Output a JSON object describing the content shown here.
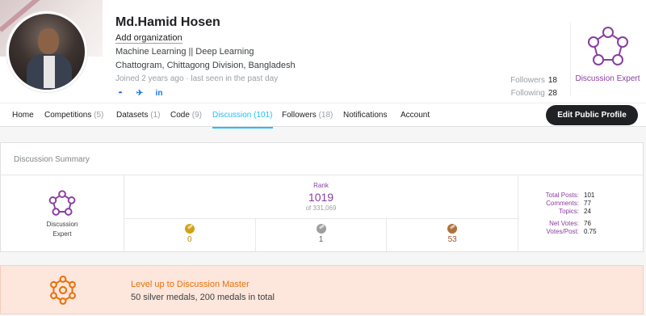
{
  "profile": {
    "name": "Md.Hamid Hosen",
    "add_org": "Add organization",
    "occupation": "Machine Learning || Deep Learning",
    "location": "Chattogram, Chittagong Division, Bangladesh",
    "joined": "Joined 2 years ago · last seen in the past day",
    "socials": [
      {
        "icon": "github-icon",
        "glyph": "◓"
      },
      {
        "icon": "twitter-icon",
        "glyph": "✈"
      },
      {
        "icon": "linkedin-icon",
        "glyph": "in"
      }
    ],
    "followers_label": "Followers",
    "followers_count": "18",
    "following_label": "Following",
    "following_count": "28",
    "tier": "Discussion Expert",
    "tier_color": "#8a3ea0"
  },
  "tabs": [
    {
      "label": "Home",
      "count": ""
    },
    {
      "label": "Competitions",
      "count": "(5)"
    },
    {
      "label": "Datasets",
      "count": "(1)"
    },
    {
      "label": "Code",
      "count": "(9)"
    },
    {
      "label": "Discussion",
      "count": "(101)",
      "active": true
    },
    {
      "label": "Followers",
      "count": "(18)"
    },
    {
      "label": "Notifications",
      "count": ""
    },
    {
      "label": "Account",
      "count": ""
    }
  ],
  "edit_profile_label": "Edit Public Profile",
  "summary": {
    "title": "Discussion Summary",
    "tier_line1": "Discussion",
    "tier_line2": "Expert",
    "rank_label": "Rank",
    "rank": "1019",
    "rank_of": "of 331,069",
    "medals": [
      {
        "type": "gold",
        "count": "0",
        "color": "#d4a017",
        "text_color": "#c9860a"
      },
      {
        "type": "silver",
        "count": "1",
        "color": "#9e9e9e",
        "text_color": "#5f6368"
      },
      {
        "type": "bronze",
        "count": "53",
        "color": "#b0703e",
        "text_color": "#a0562a"
      }
    ],
    "stats": [
      {
        "label": "Total Posts:",
        "value": "101"
      },
      {
        "label": "Comments:",
        "value": "77"
      },
      {
        "label": "Topics:",
        "value": "24"
      },
      {
        "label": "Net Votes:",
        "value": "76"
      },
      {
        "label": "Votes/Post:",
        "value": "0.75"
      }
    ]
  },
  "level_up": {
    "title": "Level up to Discussion Master",
    "subtitle": "50 silver medals, 200 medals in total",
    "accent": "#e8710a"
  }
}
